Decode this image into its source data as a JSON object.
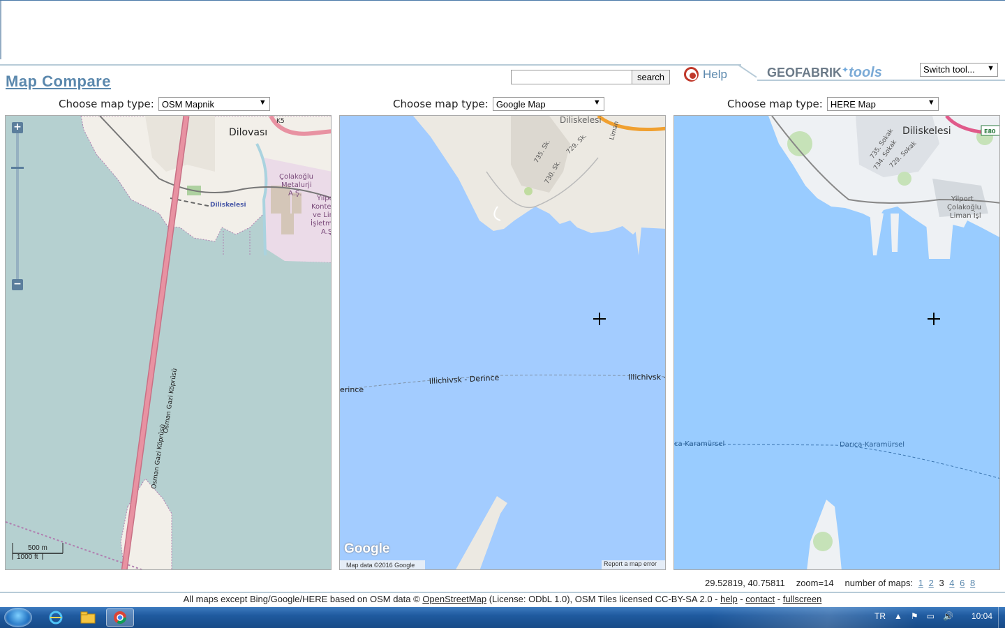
{
  "header": {
    "title": "Map Compare",
    "search_placeholder": "",
    "search_label": "search",
    "help_label": "Help",
    "brand_main": "GEOFABRIK",
    "brand_tools": "tools",
    "switch_tool": "Switch tool..."
  },
  "choosers": [
    {
      "label": "Choose map type:",
      "selected": "OSM Mapnik"
    },
    {
      "label": "Choose map type:",
      "selected": "Google Map"
    },
    {
      "label": "Choose map type:",
      "selected": "HERE Map"
    }
  ],
  "maps": {
    "osm": {
      "labels": [
        "Dilovası",
        "Diliskelesi",
        "Çolakoğlu",
        "Metalurji",
        "A.Ş.",
        "Yilpo",
        "Kontey",
        "ve Lin",
        "İşletm",
        "A.Ş",
        "Osman Gazi Köprüsü",
        "Osman Gazi Köprüsü",
        "K5"
      ],
      "scale_m": "500 m",
      "scale_ft": "1000 ft"
    },
    "google": {
      "labels": [
        "Diliskelesi",
        "735. Sk.",
        "729. Sk.",
        "730. Sk.",
        "Liman",
        "Illichivsk - Derince",
        "Illichivsk -",
        "erince"
      ],
      "logo": "Google",
      "data_text": "Map data ©2016 Google",
      "report_text": "Report a map error"
    },
    "here": {
      "labels": [
        "Diliskelesi",
        "735. Sokak",
        "734. Sokak",
        "729. Sokak",
        "Yilport",
        "Çolakoğlu",
        "Liman İşl",
        "E80",
        "ca-Karamürsel",
        "Darıca-Karamürsel"
      ]
    }
  },
  "footer": {
    "coords": "29.52819, 40.75811",
    "zoom": "zoom=14",
    "num_maps_label": "number of maps:",
    "map_counts": [
      "1",
      "2",
      "3",
      "4",
      "6",
      "8"
    ],
    "current_count": "3",
    "attribution_pre": "All maps except Bing/Google/HERE based on OSM data © ",
    "osm_link": "OpenStreetMap",
    "attribution_mid": " (License: ODbL 1.0), OSM Tiles licensed CC-BY-SA 2.0 - ",
    "help_link": "help",
    "sep1": " - ",
    "contact_link": "contact",
    "sep2": " - ",
    "fullscreen_link": "fullscreen"
  },
  "taskbar": {
    "lang": "TR",
    "time": "10:04"
  },
  "colors": {
    "accent": "#5b88ad",
    "osm_water": "#b5d0d0",
    "google_water": "#a3ccff",
    "here_water": "#99ccff",
    "osm_land": "#f2efe9",
    "osm_road": "#e892a2"
  }
}
